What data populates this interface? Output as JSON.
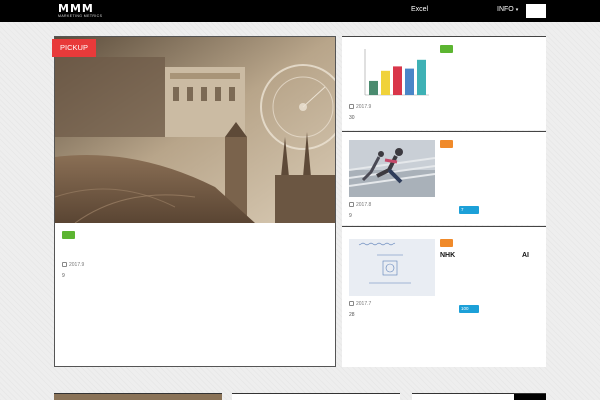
{
  "header": {
    "logo_text": "MMM",
    "logo_subtext": "MARKETING METRICS",
    "nav_excel": "Excel",
    "nav_info": "INFO",
    "nav_caret": "▾"
  },
  "pickup": {
    "tag": "PICKUP",
    "date": "2017.9",
    "count": "9",
    "badge_color": "#5cb531"
  },
  "articles": [
    {
      "date": "2017.9",
      "count": "30",
      "badge_color": "#5cb531"
    },
    {
      "date": "2017.8",
      "count": "9",
      "views": "7",
      "badge_color": "#f08a2a"
    },
    {
      "title_left": "NHK",
      "title_right": "AI",
      "date": "2017.7",
      "count": "28",
      "views": "100",
      "badge_color": "#f08a2a"
    }
  ],
  "thumb_chart": {
    "type": "bar",
    "values": [
      32,
      55,
      65,
      60,
      80
    ],
    "colors": [
      "#4a8b6f",
      "#f0d23a",
      "#d9364a",
      "#4a86c8",
      "#3eb1b5"
    ]
  },
  "colors": {
    "pickup_red": "#e83a3a",
    "view_blue": "#1ca0d8"
  }
}
